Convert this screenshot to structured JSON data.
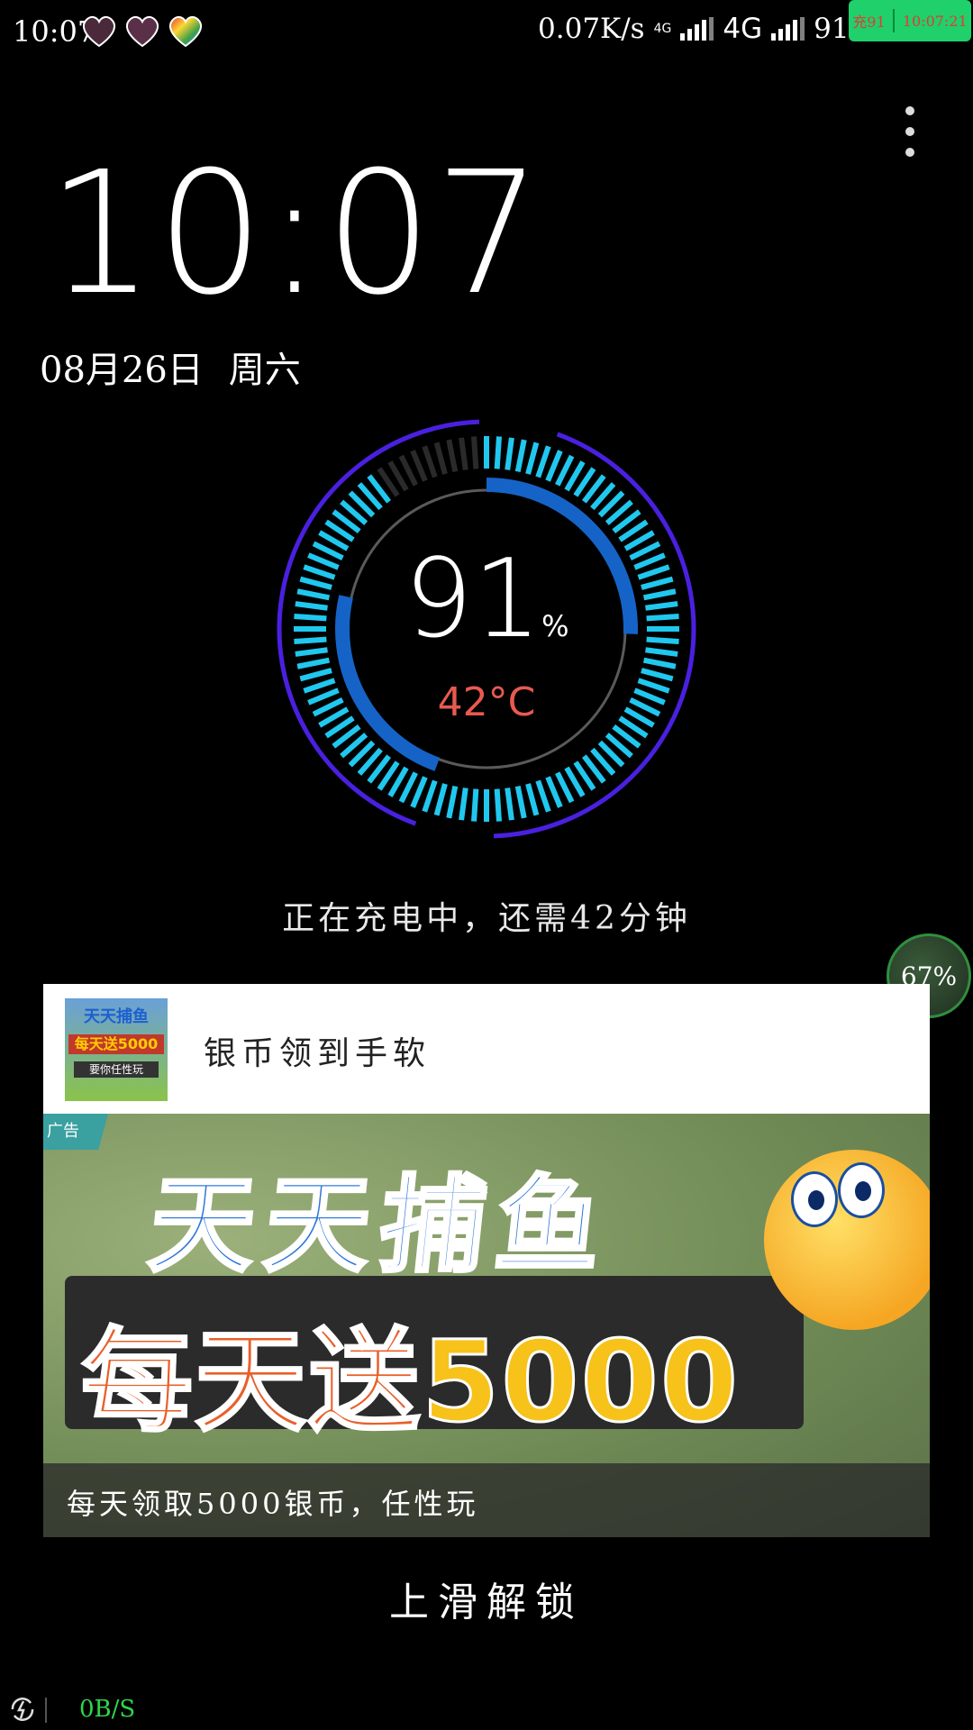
{
  "status_bar": {
    "time": "10:07",
    "net_speed": "0.07K/s",
    "net_type_small": "4G",
    "net_type": "4G",
    "battery_text": "91%",
    "overlay_left": "充91",
    "overlay_right": "10:07:21",
    "icons": [
      "heart-photo-icon",
      "heart-photo-icon",
      "heart-rainbow-icon",
      "signal-icon",
      "battery-icon"
    ]
  },
  "lock": {
    "clock": "10:07",
    "date": "08月26日",
    "weekday": "周六",
    "menu_icon": "more-vertical-icon"
  },
  "battery_gauge": {
    "percent": "91",
    "percent_sign": "%",
    "temperature": "42°C",
    "level": 0.91,
    "colors": {
      "ticks": "#20c8ef",
      "inner_arc": "#1663c7",
      "outer_arc": "#4a20e0",
      "temp": "#e85a4f"
    }
  },
  "charging_text": "正在充电中，还需42分钟",
  "cpu_bubble": "67%",
  "ad": {
    "title": "银币领到手软",
    "label": "广告",
    "thumb_line1": "天天捕鱼",
    "thumb_line2": "每天送5000",
    "thumb_line3": "要你任性玩",
    "banner_line1": "天天捕鱼",
    "banner_line2_prefix": "每天送",
    "banner_line2_number": "5000",
    "caption": "每天领取5000银币，任性玩"
  },
  "unlock_text": "上滑解锁",
  "bottom_bar": {
    "speed": "0B/S",
    "icon": "refresh-lightning-icon"
  }
}
